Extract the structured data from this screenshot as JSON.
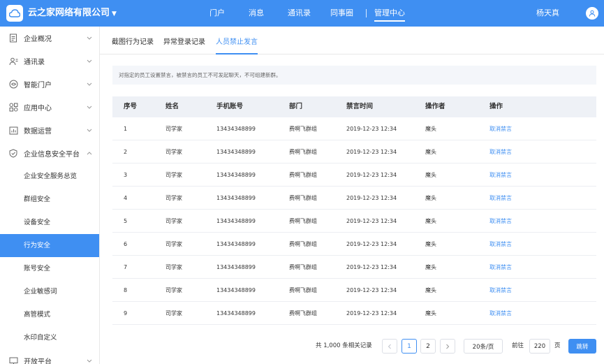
{
  "header": {
    "company": "云之家网络有限公司",
    "nav": [
      "门户",
      "消息",
      "通讯录",
      "同事圈",
      "管理中心"
    ],
    "active_nav": "管理中心",
    "user": "杨天真"
  },
  "sidebar": {
    "items": [
      {
        "label": "企业概况",
        "icon": "document-icon"
      },
      {
        "label": "通讯录",
        "icon": "contacts-icon"
      },
      {
        "label": "智能门户",
        "icon": "portal-icon"
      },
      {
        "label": "应用中心",
        "icon": "apps-icon"
      },
      {
        "label": "数据运营",
        "icon": "chart-icon"
      },
      {
        "label": "企业信息安全平台",
        "icon": "shield-icon"
      }
    ],
    "subitems": [
      "企业安全服务总览",
      "群组安全",
      "设备安全",
      "行为安全",
      "账号安全",
      "企业敏感词",
      "高管模式",
      "水印自定义"
    ],
    "active_sub": "行为安全",
    "bottom": {
      "label": "开放平台",
      "icon": "monitor-icon"
    }
  },
  "tabs": [
    "截图行为记录",
    "异常登录记录",
    "人员禁止发言"
  ],
  "active_tab": "人员禁止发言",
  "notice": "对指定的员工设置禁言，被禁言的员工不可发起聊天，不可组建新群。",
  "table": {
    "columns": [
      "序号",
      "姓名",
      "手机账号",
      "部门",
      "禁言时间",
      "操作者",
      "操作"
    ],
    "rows": [
      [
        "1",
        "司学家",
        "13434348899",
        "费啊飞群组",
        "2019-12-23 12:34",
        "魔头",
        "取消禁言"
      ],
      [
        "2",
        "司学家",
        "13434348899",
        "费啊飞群组",
        "2019-12-23 12:34",
        "魔头",
        "取消禁言"
      ],
      [
        "3",
        "司学家",
        "13434348899",
        "费啊飞群组",
        "2019-12-23 12:34",
        "魔头",
        "取消禁言"
      ],
      [
        "4",
        "司学家",
        "13434348899",
        "费啊飞群组",
        "2019-12-23 12:34",
        "魔头",
        "取消禁言"
      ],
      [
        "5",
        "司学家",
        "13434348899",
        "费啊飞群组",
        "2019-12-23 12:34",
        "魔头",
        "取消禁言"
      ],
      [
        "6",
        "司学家",
        "13434348899",
        "费啊飞群组",
        "2019-12-23 12:34",
        "魔头",
        "取消禁言"
      ],
      [
        "7",
        "司学家",
        "13434348899",
        "费啊飞群组",
        "2019-12-23 12:34",
        "魔头",
        "取消禁言"
      ],
      [
        "8",
        "司学家",
        "13434348899",
        "费啊飞群组",
        "2019-12-23 12:34",
        "魔头",
        "取消禁言"
      ],
      [
        "9",
        "司学家",
        "13434348899",
        "费啊飞群组",
        "2019-12-23 12:34",
        "魔头",
        "取消禁言"
      ]
    ]
  },
  "pagination": {
    "total": "共 1,000 条相关记录",
    "pages": [
      "1",
      "2"
    ],
    "current": "1",
    "page_size": "20条/页",
    "goto_label": "前往",
    "goto_value": "220",
    "page_unit": "页",
    "jump_label": "跳转"
  },
  "colors": {
    "brand": "#3f8ff2"
  }
}
